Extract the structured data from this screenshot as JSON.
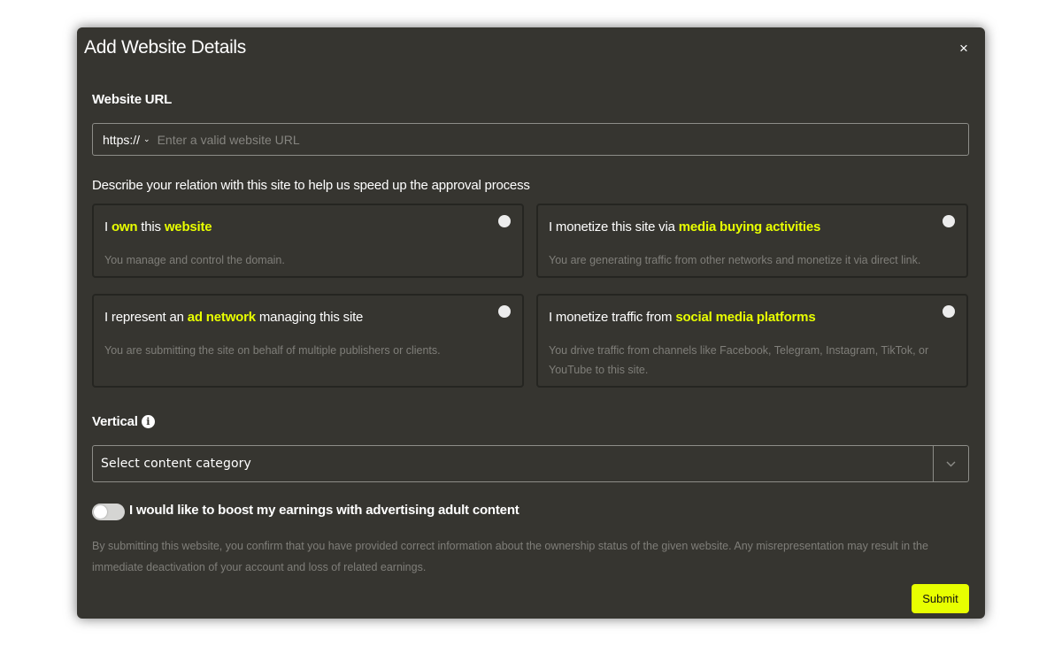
{
  "modal": {
    "title": "Add Website Details",
    "close_label": "×"
  },
  "website_url": {
    "label": "Website URL",
    "protocol": "https://",
    "placeholder": "Enter a valid website URL",
    "value": ""
  },
  "relation": {
    "prompt": "Describe your relation with this site to help us speed up the approval process",
    "options": [
      {
        "title_parts": [
          "I ",
          "own",
          " this ",
          "website",
          ""
        ],
        "description": "You manage and control the domain."
      },
      {
        "title_parts": [
          "I monetize this site via ",
          "media buying activities",
          ""
        ],
        "description": "You are generating traffic from other networks and monetize it via direct link."
      },
      {
        "title_parts": [
          "I represent an ",
          "ad network",
          " managing this site"
        ],
        "description": "You are submitting the site on behalf of multiple publishers or clients."
      },
      {
        "title_parts": [
          "I monetize traffic from ",
          "social media platforms",
          ""
        ],
        "description": "You drive traffic from channels like Facebook, Telegram, Instagram, TikTok, or YouTube to this site."
      }
    ]
  },
  "vertical": {
    "label": "Vertical",
    "info_icon": "info-icon",
    "selected": "Select content category"
  },
  "adult_toggle": {
    "label": "I would like to boost my earnings with advertising adult content",
    "checked": false
  },
  "disclaimer": "By submitting this website, you confirm that you have provided correct information about the ownership status of the given website. Any misrepresentation may result in the immediate deactivation of your account and loss of related earnings.",
  "submit_label": "Submit",
  "colors": {
    "modal_bg": "#363530",
    "accent": "#e8ff00",
    "muted_text": "#7f7e79",
    "border": "#8d8d88"
  }
}
